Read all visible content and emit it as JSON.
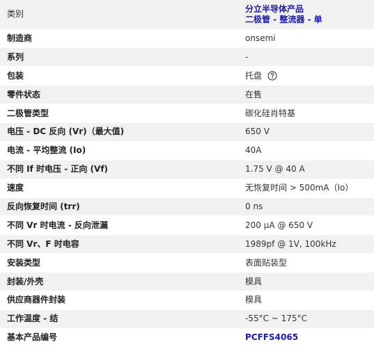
{
  "attributes": [
    {
      "name": "类别",
      "value": "分立半导体产品",
      "value_line2": "二极管 - 整流器 - 单",
      "link": true
    },
    {
      "name": "制造商",
      "value": "onsemi"
    },
    {
      "name": "系列",
      "value": "-"
    },
    {
      "name": "包装",
      "value": "托盘",
      "help_icon": "question-circle-icon"
    },
    {
      "name": "零件状态",
      "value": "在售"
    },
    {
      "name": "二极管类型",
      "value": "碳化硅肖特基"
    },
    {
      "name": "电压 - DC 反向 (Vr)（最大值)",
      "value": "650 V"
    },
    {
      "name": "电流 - 平均整流 (Io)",
      "value": "40A"
    },
    {
      "name": "不同 If 时电压 - 正向 (Vf)",
      "value": "1.75 V @ 40 A"
    },
    {
      "name": "速度",
      "value": "无恢复时间 > 500mA（Io）"
    },
    {
      "name": "反向恢复时间 (trr)",
      "value": "0 ns"
    },
    {
      "name": "不同 Vr 时电流 - 反向泄漏",
      "value": "200 µA @ 650 V"
    },
    {
      "name": "不同 Vr、F 时电容",
      "value": "1989pf @ 1V, 100kHz"
    },
    {
      "name": "安装类型",
      "value": "表面贴装型"
    },
    {
      "name": "封装/外壳",
      "value": "模具"
    },
    {
      "name": "供应商器件封装",
      "value": "模具"
    },
    {
      "name": "工作温度 - 结",
      "value": "-55°C ~ 175°C"
    },
    {
      "name": "基本产品编号",
      "value": "PCFFS4065",
      "link": true
    }
  ],
  "colors": {
    "row_shaded": "#f1f1f1",
    "row_plain": "#ffffff",
    "link": "#1a1aa6"
  }
}
